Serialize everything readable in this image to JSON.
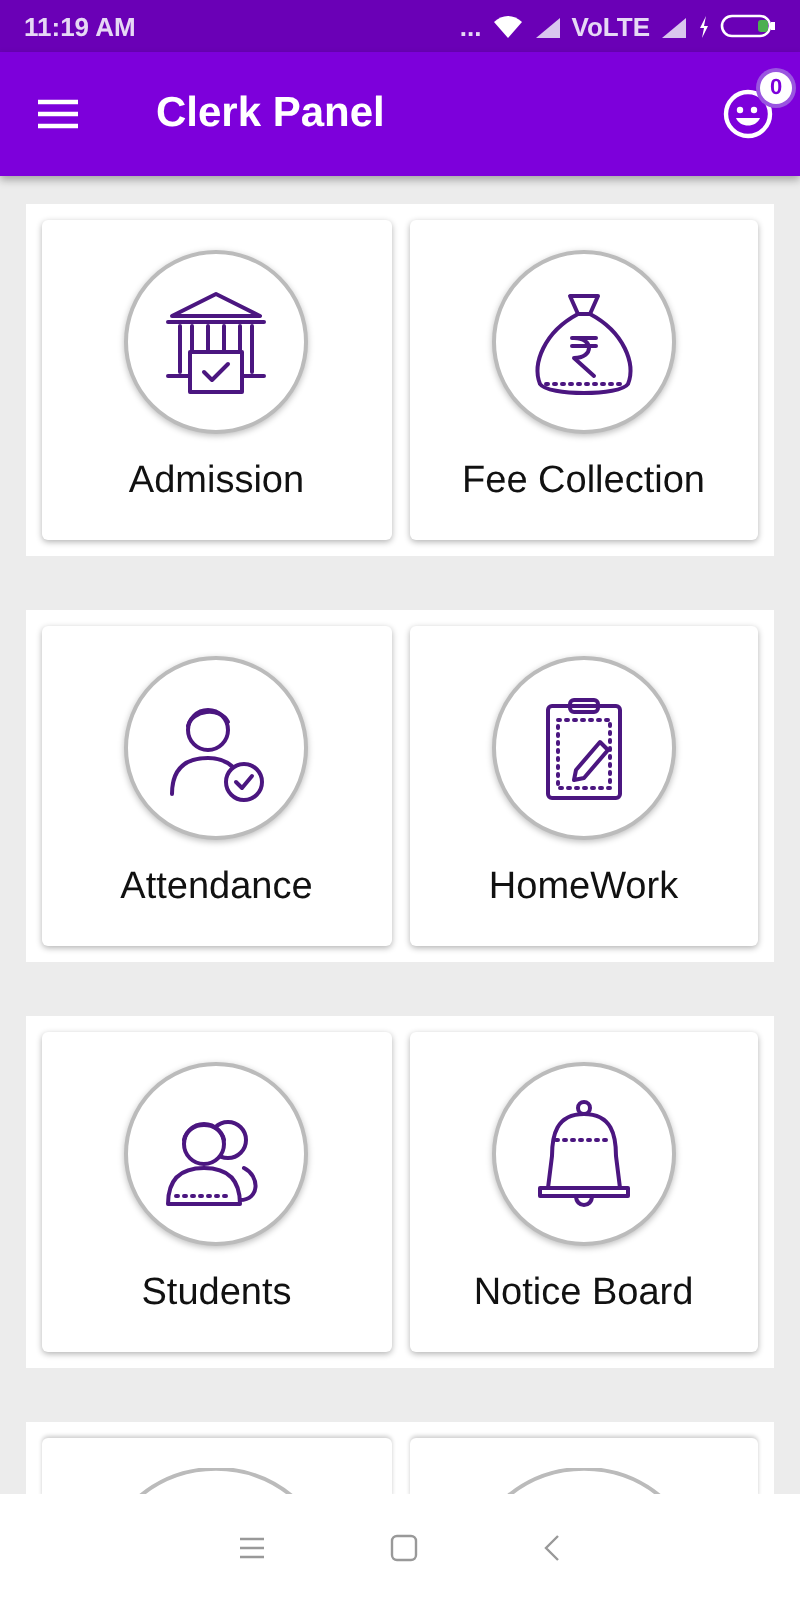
{
  "status_bar": {
    "time": "11:19 AM",
    "dots": "...",
    "network": "VoLTE"
  },
  "app_bar": {
    "title": "Clerk Panel",
    "badge": "0"
  },
  "rows": [
    {
      "tiles": [
        {
          "kind": "tile",
          "label": "Admission"
        },
        {
          "kind": "tile",
          "label": "Fee Collection"
        }
      ]
    },
    {
      "tiles": [
        {
          "kind": "tile",
          "label": "Attendance"
        },
        {
          "kind": "tile",
          "label": "HomeWork"
        }
      ]
    },
    {
      "tiles": [
        {
          "kind": "tile",
          "label": "Students"
        },
        {
          "kind": "tile",
          "label": "Notice Board"
        }
      ]
    },
    {
      "tiles": [
        {
          "kind": "cut"
        },
        {
          "kind": "cut"
        }
      ]
    }
  ]
}
